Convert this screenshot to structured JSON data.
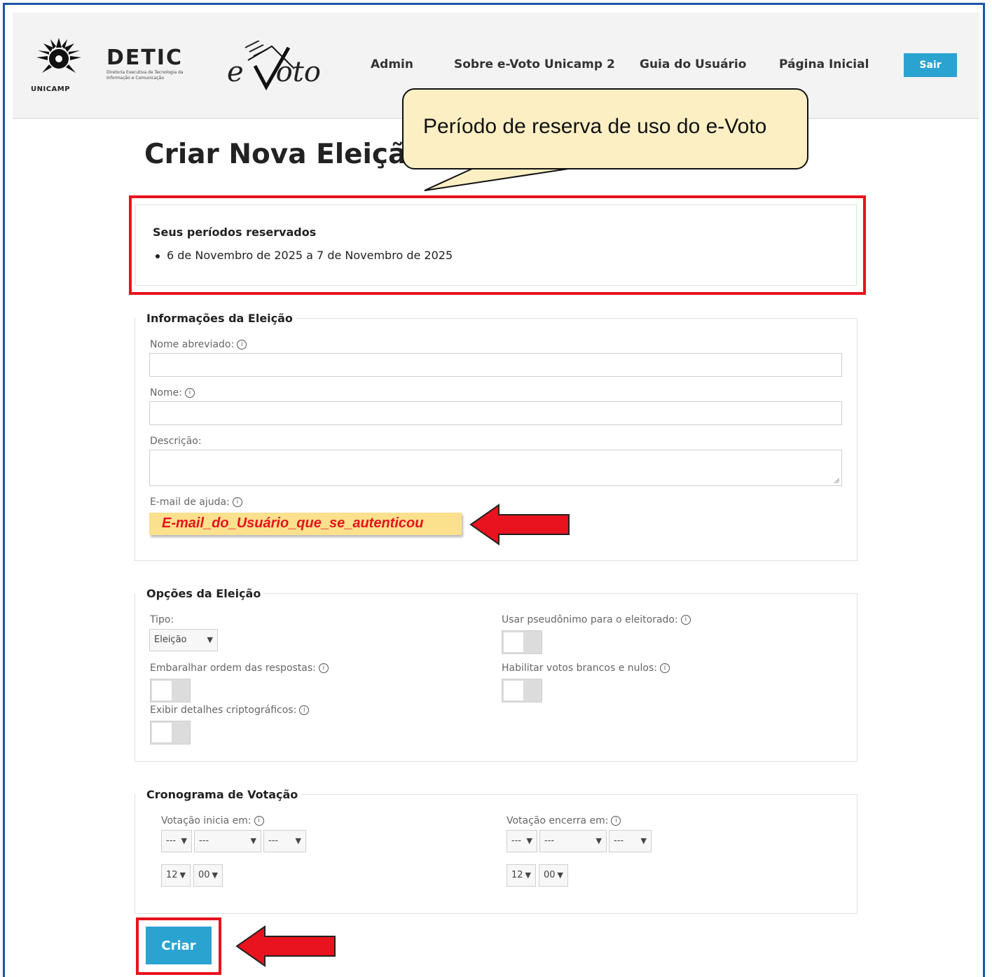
{
  "header": {
    "unicamp_text": "UNICAMP",
    "detic_text": "DETIC",
    "detic_subtitle": "Diretoria Executiva de Tecnologia da Informação e Comunicação",
    "evoto_text": "e-Voto",
    "nav": [
      "Admin",
      "Sobre e-Voto Unicamp 2",
      "Guia do Usuário",
      "Página Inicial"
    ],
    "logout_label": "Sair"
  },
  "page": {
    "title": "Criar Nova Eleição"
  },
  "callout": {
    "text": "Período de reserva de uso do e-Voto"
  },
  "reserved": {
    "title": "Seus períodos reservados",
    "items": [
      "6 de Novembro de 2025 a 7 de Novembro de 2025"
    ]
  },
  "info_section": {
    "legend": "Informações da Eleição",
    "short_name_label": "Nome abreviado:",
    "name_label": "Nome:",
    "description_label": "Descrição:",
    "help_email_label": "E-mail de ajuda:",
    "help_email_value": "E-mail_do_Usuário_que_se_autenticou"
  },
  "options_section": {
    "legend": "Opções da Eleição",
    "type_label": "Tipo:",
    "type_value": "Eleição",
    "shuffle_label": "Embaralhar ordem das respostas:",
    "crypto_label": "Exibir detalhes criptográficos:",
    "pseudonym_label": "Usar pseudônimo para o eleitorado:",
    "blank_votes_label": "Habilitar votos brancos e nulos:"
  },
  "schedule_section": {
    "legend": "Cronograma de Votação",
    "start_label": "Votação inicia em:",
    "end_label": "Votação encerra em:",
    "date_placeholder": "---",
    "hour_value": "12",
    "minute_value": "00"
  },
  "submit_label": "Criar",
  "colors": {
    "accent": "#2aa3d1",
    "highlight_red": "#e8131e",
    "callout_bg": "#fdefc4",
    "email_bg": "#fbe08d"
  }
}
